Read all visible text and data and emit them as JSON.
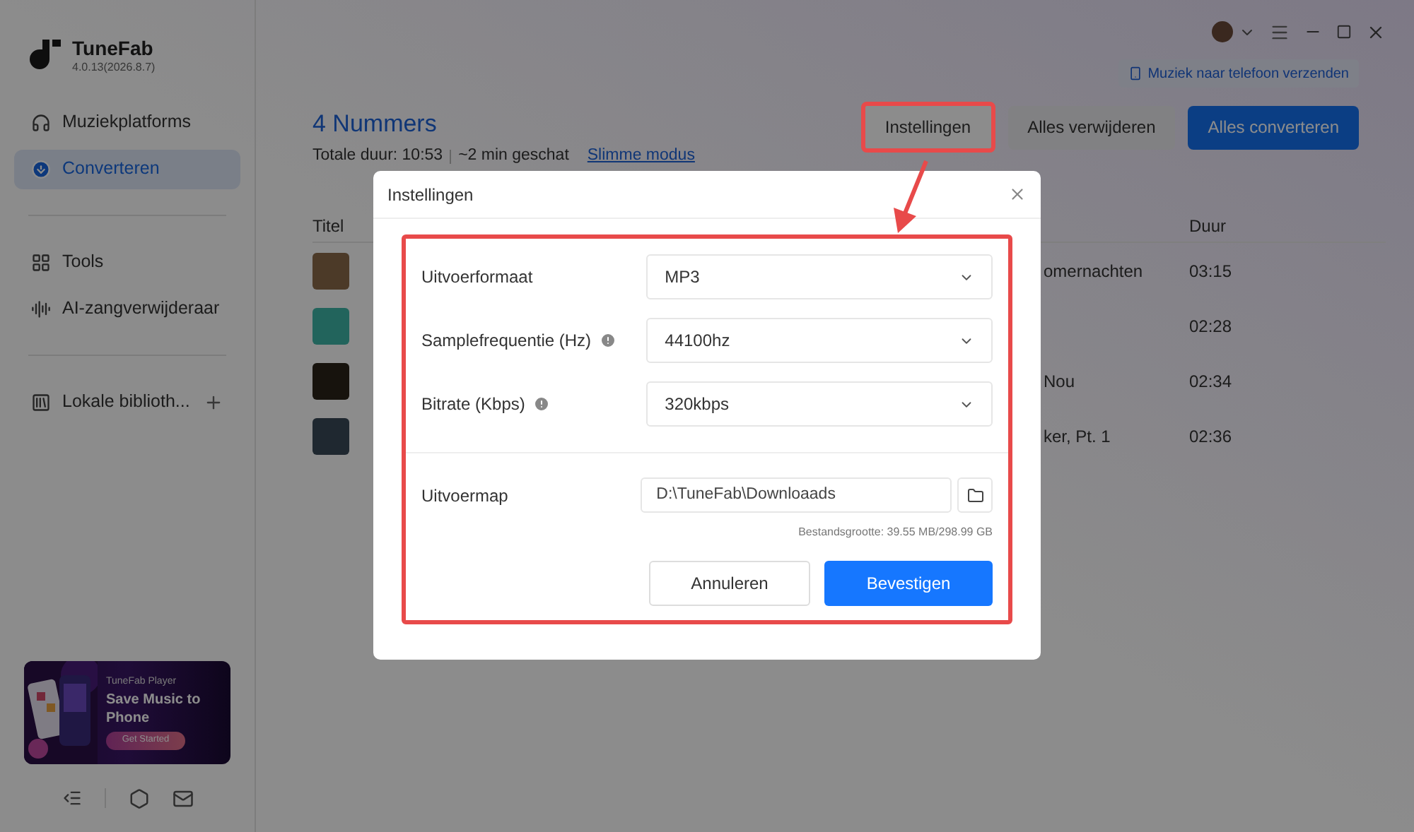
{
  "app": {
    "name": "TuneFab",
    "version": "4.0.13(2026.8.7)"
  },
  "sidebar": {
    "items": [
      {
        "kind": "platforms",
        "label": "Muziekplatforms",
        "selected": false
      },
      {
        "kind": "convert",
        "label": "Converteren",
        "selected": true
      },
      {
        "kind": "divider"
      },
      {
        "kind": "tools",
        "label": "Tools",
        "selected": false
      },
      {
        "kind": "vocal",
        "label": "AI-zangverwijderaar",
        "selected": false
      },
      {
        "kind": "divider"
      },
      {
        "kind": "library",
        "label": "Lokale biblioth...",
        "selected": false
      }
    ],
    "promo": {
      "caption": "TuneFab Player",
      "headline": "Save Music to Phone",
      "button": "Get Started"
    }
  },
  "header": {
    "send_button": "Muziek naar telefoon verzenden"
  },
  "main": {
    "title": "4 Nummers",
    "total": "Totale duur: 10:53",
    "estimate": "~2 min geschat",
    "mode_link": "Slimme modus",
    "buttons": [
      {
        "kind": "plain",
        "label": "Instellingen",
        "highlighted": true
      },
      {
        "kind": "secondary",
        "label": "Alles verwijderen",
        "highlighted": false
      },
      {
        "kind": "primary",
        "label": "Alles converteren",
        "highlighted": false
      }
    ],
    "table": {
      "columns": [
        "Titel",
        "Duur"
      ],
      "rows": [
        {
          "album": "omernachten",
          "duration": "03:15"
        },
        {
          "duration": "02:28"
        },
        {
          "album": "Nou",
          "duration": "02:34"
        },
        {
          "album": "ker, Pt. 1",
          "duration": "02:36"
        }
      ]
    }
  },
  "dialog": {
    "title": "Instellingen",
    "settings": [
      {
        "label": "Uitvoerformaat",
        "info": false,
        "value": "MP3"
      },
      {
        "label": "Samplefrequentie (Hz)",
        "info": true,
        "value": "44100hz"
      },
      {
        "label": "Bitrate (Kbps)",
        "info": true,
        "value": "320kbps"
      }
    ],
    "folder": {
      "label": "Uitvoermap",
      "value": "D:\\TuneFab\\Downloaads"
    },
    "size": "Bestandsgrootte: 39.55 MB/298.99 GB",
    "buttons": [
      {
        "kind": "secondary",
        "label": "Annuleren"
      },
      {
        "kind": "primary",
        "label": "Bevestigen"
      }
    ]
  }
}
